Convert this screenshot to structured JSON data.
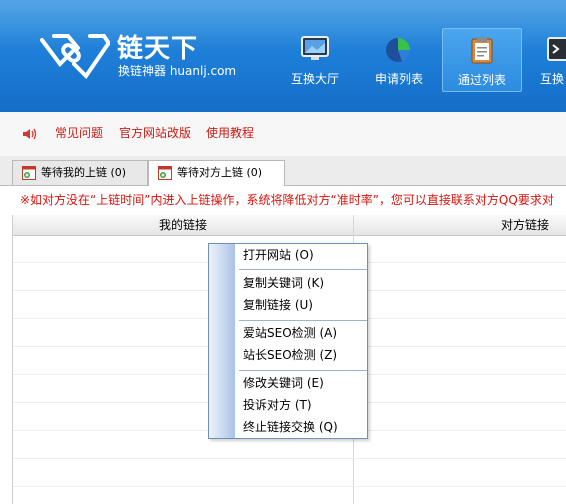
{
  "brand": {
    "title": "链天下",
    "subtitle": "换链神器 huanlj.com"
  },
  "nav": [
    {
      "label": "互换大厅",
      "icon": "monitor-icon"
    },
    {
      "label": "申请列表",
      "icon": "pie-chart-icon"
    },
    {
      "label": "通过列表",
      "icon": "clipboard-icon",
      "active": true
    },
    {
      "label": "互换",
      "icon": "terminal-icon"
    }
  ],
  "links": {
    "faq": "常见问题",
    "revamp": "官方网站改版",
    "tutorial": "使用教程"
  },
  "tabs": [
    {
      "label": "等待我的上链 (0)"
    },
    {
      "label": "等待对方上链 (0)",
      "active": true
    }
  ],
  "notice": "※如对方没在“上链时间”内进入上链操作，系统将降低对方“准时率”，您可以直接联系对方QQ要求对",
  "table": {
    "columns": [
      "我的链接",
      "对方链接"
    ]
  },
  "context_menu": {
    "open_site": "打开网站 (O)",
    "copy_keyword": "复制关键词 (K)",
    "copy_link": "复制链接 (U)",
    "aizhan_seo": "爱站SEO检测 (A)",
    "zhanzhang_seo": "站长SEO检测 (Z)",
    "edit_keyword": "修改关键词 (E)",
    "complain": "投诉对方 (T)",
    "terminate": "终止链接交换 (Q)"
  },
  "colors": {
    "header_blue": "#1c7cd6",
    "link_red": "#c81d16",
    "notice_red": "#d8140c"
  }
}
